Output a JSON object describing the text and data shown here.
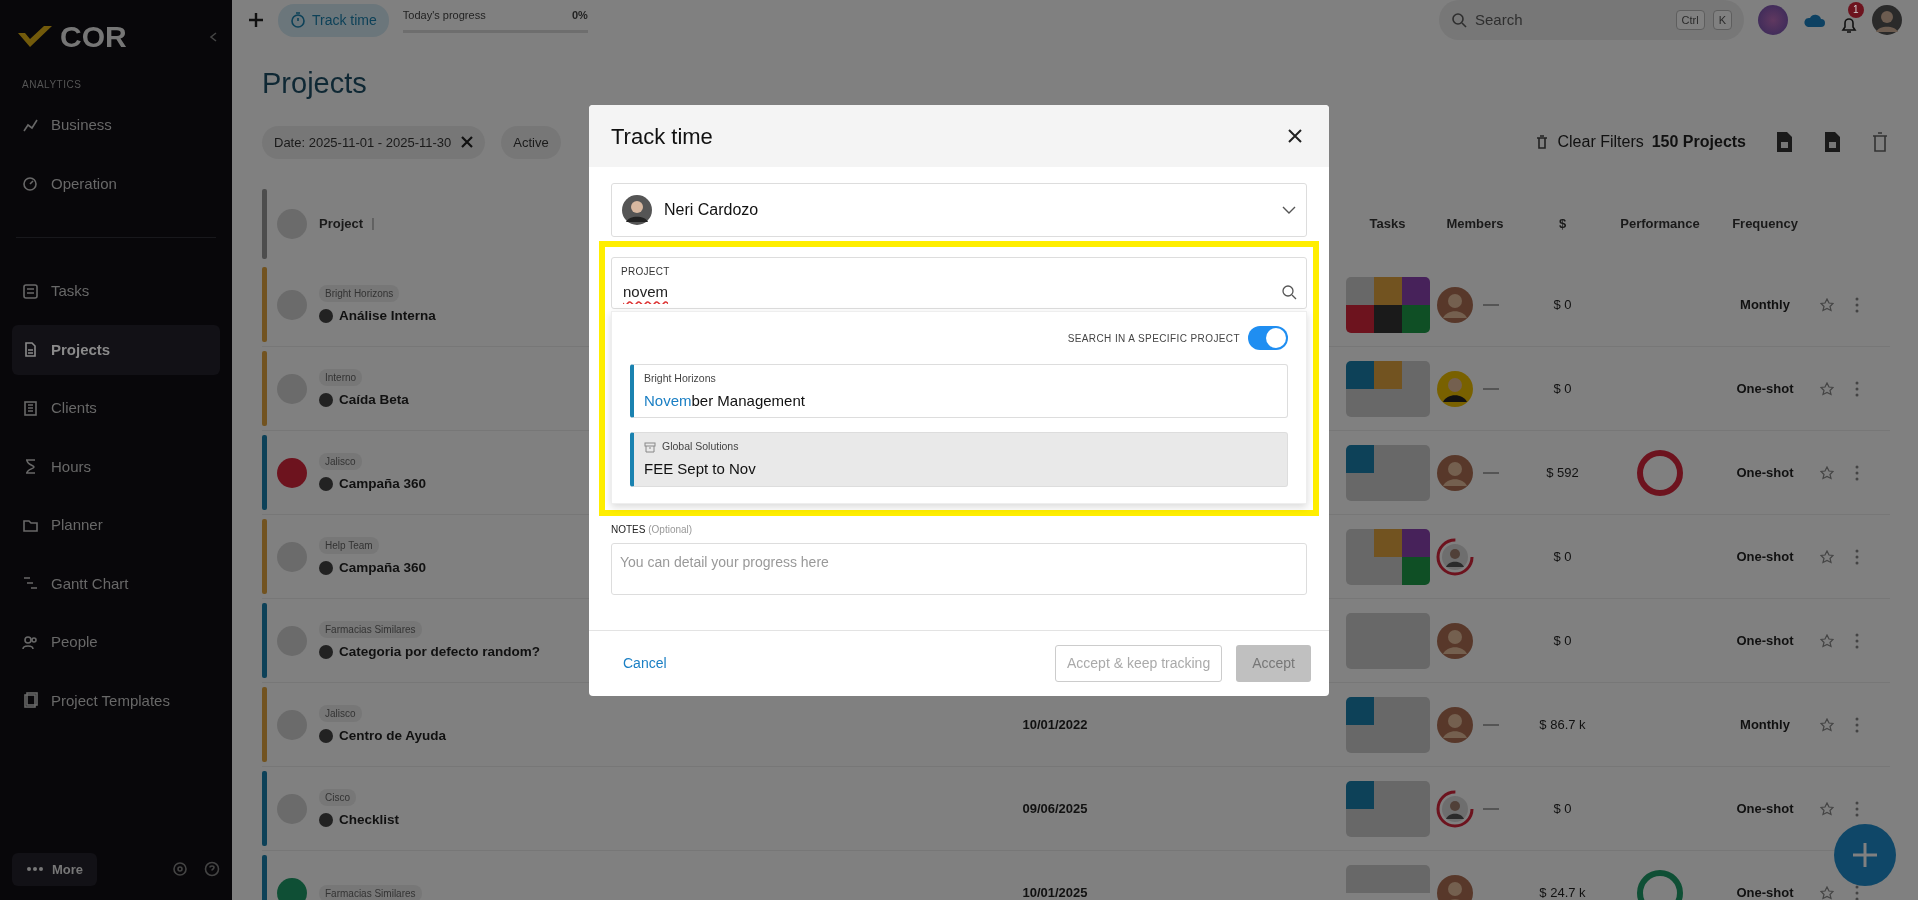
{
  "sidebar": {
    "logo": "COR",
    "section_label": "ANALYTICS",
    "analytics_items": [
      {
        "label": "Business",
        "selected": false
      },
      {
        "label": "Operation",
        "selected": false
      }
    ],
    "items": [
      {
        "label": "Tasks",
        "selected": false
      },
      {
        "label": "Projects",
        "selected": true
      },
      {
        "label": "Clients",
        "selected": false
      },
      {
        "label": "Hours",
        "selected": false
      },
      {
        "label": "Planner",
        "selected": false
      },
      {
        "label": "Gantt Chart",
        "selected": false
      },
      {
        "label": "People",
        "selected": false
      },
      {
        "label": "Project Templates",
        "selected": false
      }
    ],
    "more_button": "More"
  },
  "topbar": {
    "track_time": "Track time",
    "progress_label": "Today's progress",
    "progress_value": "0%",
    "progress": {
      "level": 0
    },
    "search_placeholder": "Search",
    "shortcut_keys": [
      "Ctrl",
      "K"
    ],
    "notification_count": "1"
  },
  "page": {
    "title": "Projects",
    "filters": [
      {
        "label": "Date: 2025-11-01 - 2025-11-30",
        "removable": true
      },
      {
        "label": "Active",
        "removable": false
      }
    ],
    "clear_filters": "Clear Filters",
    "project_count": "150 Projects"
  },
  "table": {
    "columns": [
      "Project",
      "Tasks",
      "Members",
      "$",
      "Performance",
      "Frequency"
    ],
    "rows": [
      {
        "color": "#725320",
        "client": "Bright Horizons",
        "name": "Análise Interna",
        "tasks": [
          {
            "color": "#686868"
          },
          {
            "color": "#725320"
          },
          {
            "color": "#47225a"
          },
          {
            "color": "#6d131e"
          },
          {
            "color": "#1a1a1a"
          },
          {
            "color": "#0f4f25"
          }
        ],
        "member": {
          "kind": "photo"
        },
        "more_members": true,
        "amount": "$ 0",
        "frequency": "Monthly"
      },
      {
        "color": "#725320",
        "client": "Interno",
        "name": "Caída Beta",
        "tasks": [
          {
            "color": "#0d4158"
          },
          {
            "color": "#725320"
          },
          {
            "color": "#686868"
          },
          {
            "color": "#686868"
          },
          {
            "color": "#686868"
          },
          {
            "color": "#686868"
          }
        ],
        "member": {
          "kind": "yellow"
        },
        "more_members": true,
        "amount": "$ 0",
        "frequency": "One-shot"
      },
      {
        "color": "#0d4158",
        "status": {
          "color": "#6d131e"
        },
        "client": "Jalisco",
        "name": "Campaña 360",
        "tasks": [
          {
            "color": "#0d4158"
          },
          {
            "color": "#686868"
          },
          {
            "color": "#686868"
          },
          {
            "color": "#686868"
          },
          {
            "color": "#686868"
          },
          {
            "color": "#686868"
          }
        ],
        "member": {
          "kind": "photo"
        },
        "more_members": true,
        "amount": "$ 592",
        "performance": {
          "color": "#6d131e"
        },
        "frequency": "One-shot"
      },
      {
        "color": "#725320",
        "client": "Help Team",
        "name": "Campaña 360",
        "tasks": [
          {
            "color": "#686868"
          },
          {
            "color": "#725320"
          },
          {
            "color": "#47225a"
          },
          {
            "color": "#686868"
          },
          {
            "color": "#686868"
          },
          {
            "color": "#0f4f25"
          }
        ],
        "member": {
          "kind": "ring"
        },
        "more_members": false,
        "amount": "$ 0",
        "frequency": "One-shot"
      },
      {
        "color": "#0d4158",
        "client": "Farmacias Similares",
        "name": "Categoria por defecto random?",
        "tasks": [
          {
            "color": "#686868"
          },
          {
            "color": "#686868"
          },
          {
            "color": "#686868"
          },
          {
            "color": "#686868"
          },
          {
            "color": "#686868"
          },
          {
            "color": "#686868"
          }
        ],
        "member": {
          "kind": "photo"
        },
        "more_members": false,
        "amount": "$ 0",
        "frequency": "One-shot"
      },
      {
        "color": "#725320",
        "client": "Jalisco",
        "name": "Centro de Ayuda",
        "date": "10/01/2022",
        "tasks": [
          {
            "color": "#0d4158"
          },
          {
            "color": "#686868"
          },
          {
            "color": "#686868"
          },
          {
            "color": "#686868"
          },
          {
            "color": "#686868"
          },
          {
            "color": "#686868"
          }
        ],
        "member": {
          "kind": "photo"
        },
        "more_members": true,
        "amount": "$ 86.7 k",
        "frequency": "Monthly"
      },
      {
        "color": "#0d4158",
        "client": "Cisco",
        "name": "Checklist",
        "date": "09/06/2025",
        "tasks": [
          {
            "color": "#0d4158"
          },
          {
            "color": "#686868"
          },
          {
            "color": "#686868"
          },
          {
            "color": "#686868"
          },
          {
            "color": "#686868"
          },
          {
            "color": "#686868"
          }
        ],
        "member": {
          "kind": "ring"
        },
        "more_members": true,
        "amount": "$ 0",
        "frequency": "One-shot"
      },
      {
        "color": "#0d4158",
        "status": {
          "color": "#0f4f35"
        },
        "client": "Farmacias Similares",
        "date": "10/01/2025",
        "tasks": [
          {
            "color": "#686868"
          },
          {
            "color": "#686868"
          },
          {
            "color": "#686868"
          }
        ],
        "member": {
          "kind": "photo"
        },
        "more_members": false,
        "amount": "$ 24.7 k",
        "performance": {
          "color": "#0f4f35"
        },
        "frequency": "One-shot"
      }
    ]
  },
  "modal": {
    "title": "Track time",
    "user": {
      "name": "Neri Cardozo"
    },
    "project_field": {
      "label": "PROJECT",
      "value": "novem",
      "highlighted": true
    },
    "dropdown": {
      "toggle_label": "SEARCH IN A SPECIFIC PROJECT",
      "toggle_on": true,
      "results": [
        {
          "client": "Bright Horizons",
          "archived": false,
          "selected": false,
          "name_parts": [
            {
              "text": "Novem",
              "match": true
            },
            {
              "text": "ber Management",
              "match": false
            }
          ]
        },
        {
          "client": "Global Solutions",
          "archived": true,
          "selected": true,
          "name_parts": [
            {
              "text": "FEE Sept to Nov",
              "match": false
            }
          ]
        }
      ]
    },
    "notes": {
      "label": "NOTES",
      "hint": "(Optional)",
      "placeholder": "You can detail your progress here"
    },
    "buttons": [
      {
        "label": "Cancel",
        "kind": "link",
        "disabled": false
      },
      {
        "label": "Accept & keep tracking",
        "kind": "outline",
        "disabled": true
      },
      {
        "label": "Accept",
        "kind": "solid",
        "disabled": true
      }
    ]
  }
}
